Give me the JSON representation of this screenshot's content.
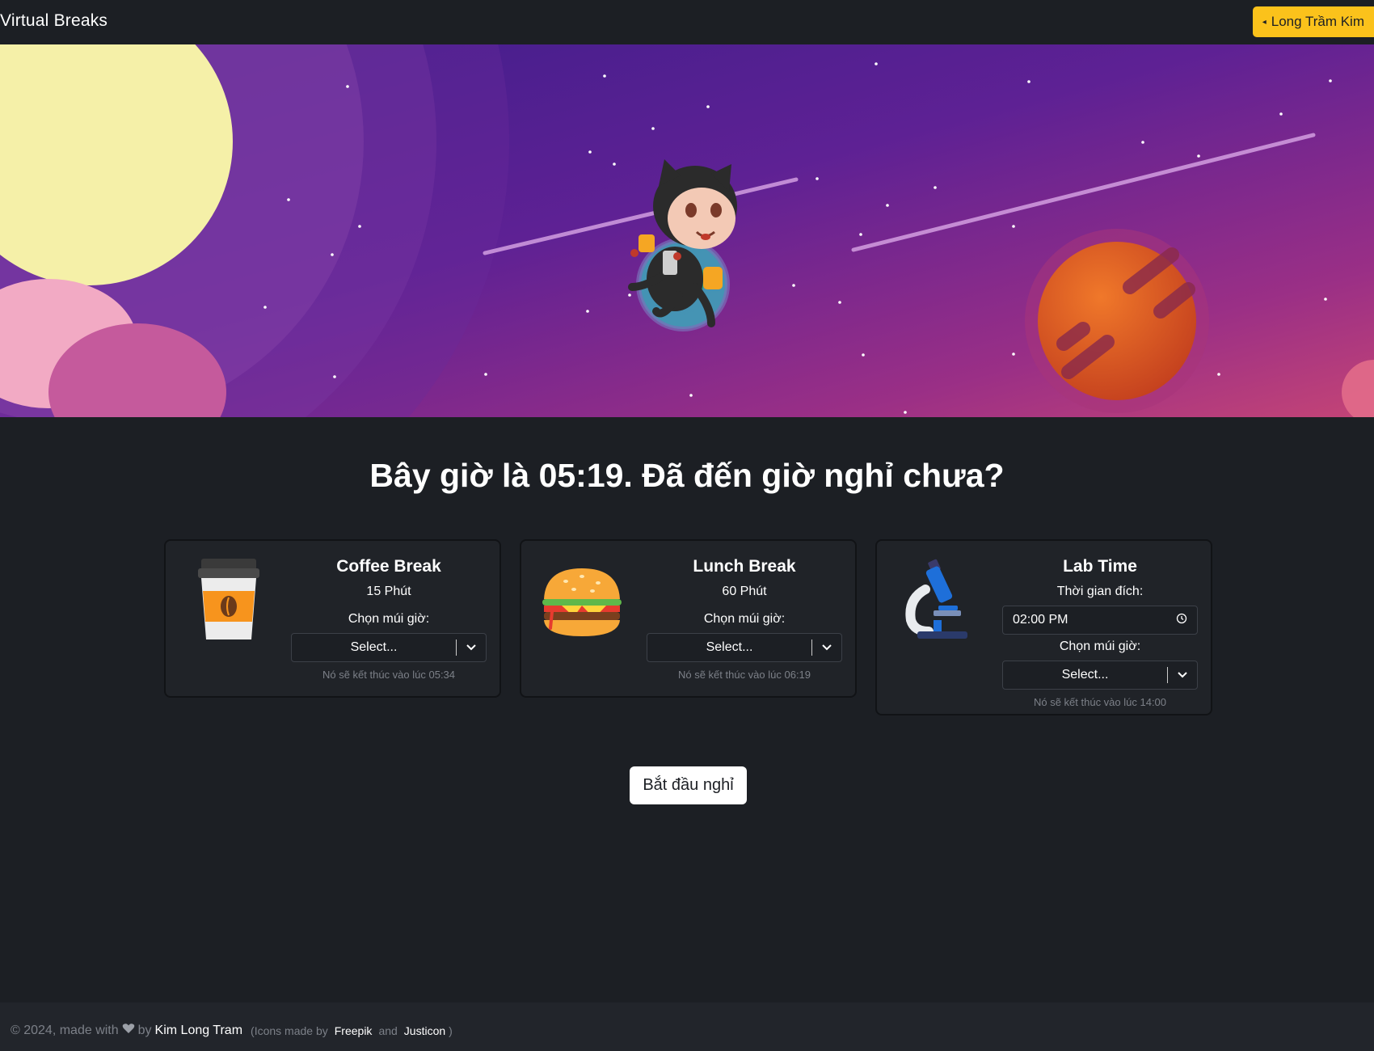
{
  "navbar": {
    "brand": "Virtual Breaks",
    "user_button": "Long Trầm Kim"
  },
  "headline": "Bây giờ là 05:19. Đã đến giờ nghỉ chưa?",
  "cards": [
    {
      "icon": "coffee-cup-icon",
      "title": "Coffee Break",
      "duration": "15 Phút",
      "timezone_label": "Chọn múi giờ:",
      "select_value": "Select...",
      "hint": "Nó sẽ kết thúc vào lúc 05:34"
    },
    {
      "icon": "burger-icon",
      "title": "Lunch Break",
      "duration": "60 Phút",
      "timezone_label": "Chọn múi giờ:",
      "select_value": "Select...",
      "hint": "Nó sẽ kết thúc vào lúc 06:19"
    },
    {
      "icon": "microscope-icon",
      "title": "Lab Time",
      "target_label": "Thời gian đích:",
      "time_value": "02:00 PM",
      "timezone_label": "Chọn múi giờ:",
      "select_value": "Select...",
      "hint": "Nó sẽ kết thúc vào lúc 14:00"
    }
  ],
  "start_button": "Bắt đầu nghỉ",
  "footer": {
    "copyright": "© 2024, made with",
    "by": "by",
    "author": "Kim Long Tram",
    "icons_prefix": "(Icons made by",
    "icon_author_1": "Freepik",
    "and": "and",
    "icon_author_2": "Justicon",
    "icons_suffix": ")"
  },
  "colors": {
    "background": "#1c1f24",
    "accent": "#fbc21b",
    "card": "#202328",
    "muted": "#7c8088"
  }
}
